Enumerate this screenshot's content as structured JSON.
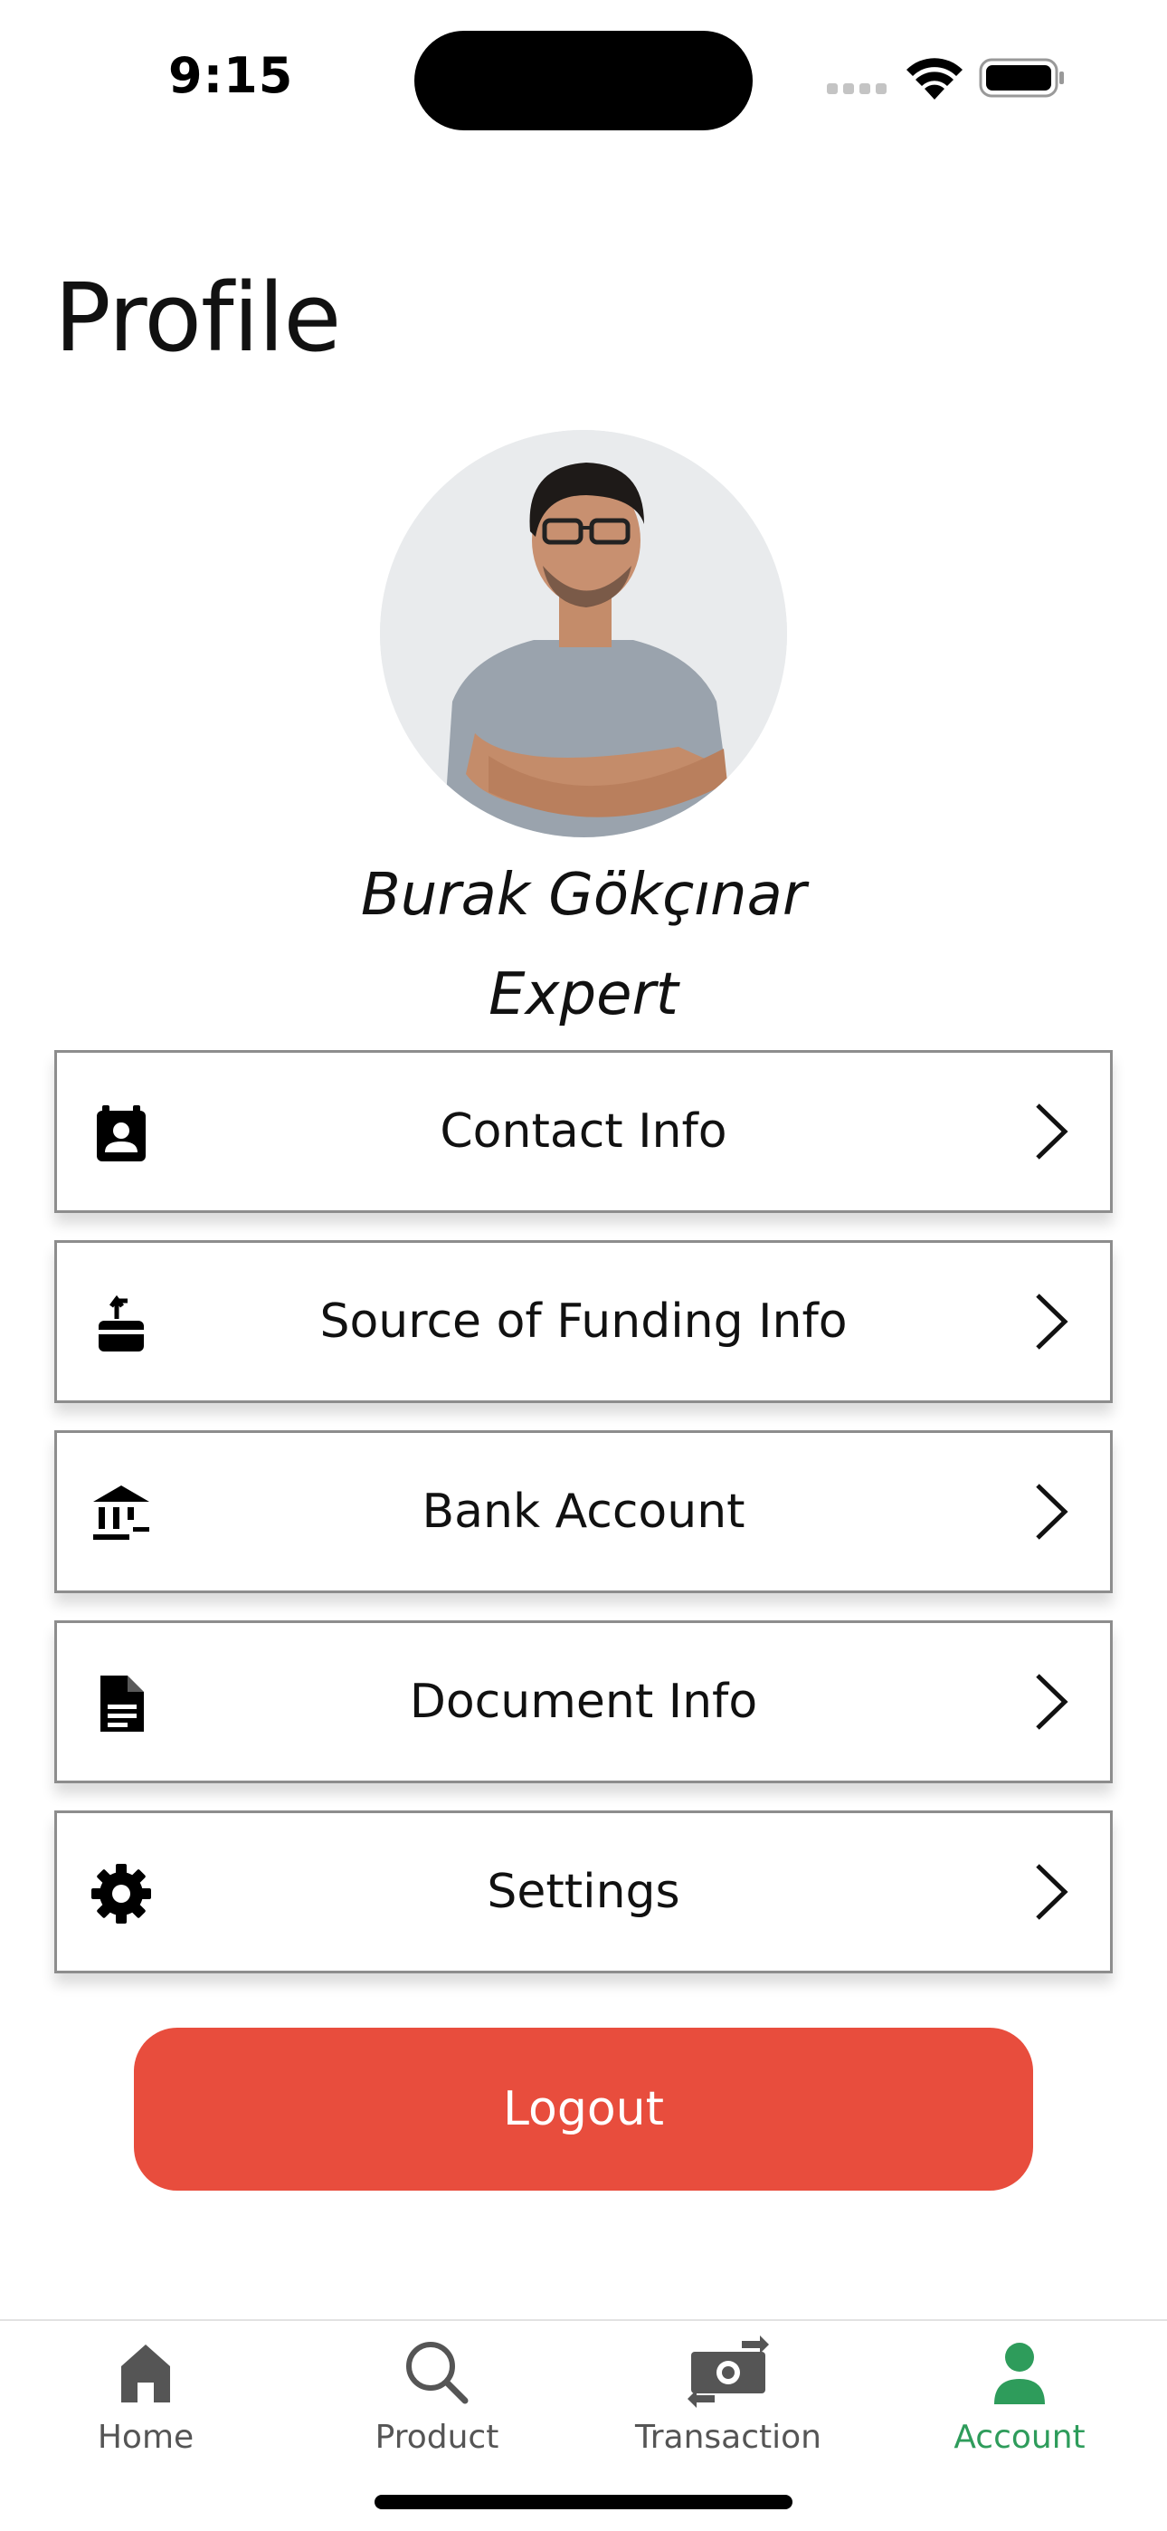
{
  "status_bar": {
    "time": "9:15"
  },
  "page": {
    "title": "Profile"
  },
  "profile": {
    "name": "Burak Gökçınar",
    "role": "Expert"
  },
  "menu": [
    {
      "label": "Contact Info",
      "icon": "contact-card-icon"
    },
    {
      "label": "Source of Funding Info",
      "icon": "wallet-transfer-icon"
    },
    {
      "label": "Bank Account",
      "icon": "bank-icon"
    },
    {
      "label": "Document Info",
      "icon": "document-icon"
    },
    {
      "label": "Settings",
      "icon": "gear-icon"
    }
  ],
  "logout": {
    "label": "Logout",
    "color": "#E84D3D"
  },
  "tabs": [
    {
      "label": "Home",
      "icon": "home-icon",
      "active": false
    },
    {
      "label": "Product",
      "icon": "search-icon",
      "active": false
    },
    {
      "label": "Transaction",
      "icon": "money-transfer-icon",
      "active": false
    },
    {
      "label": "Account",
      "icon": "person-icon",
      "active": true
    }
  ],
  "colors": {
    "accent_active": "#2E9C5B",
    "tab_inactive": "#555555"
  }
}
